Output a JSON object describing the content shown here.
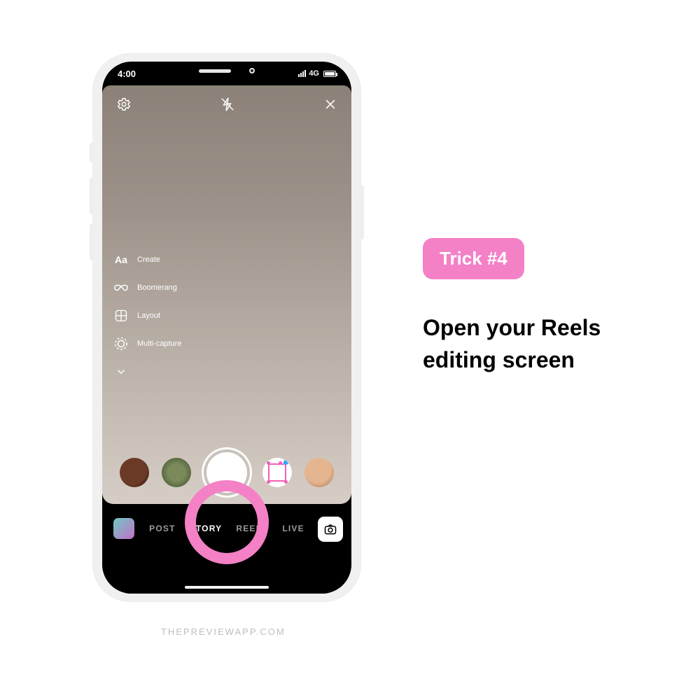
{
  "status": {
    "time": "4:00",
    "network": "4G"
  },
  "tools": {
    "create": "Create",
    "boomerang": "Boomerang",
    "layout": "Layout",
    "multicapture": "Multi-capture"
  },
  "modes": {
    "post": "POST",
    "story": "STORY",
    "reels": "REELS",
    "live": "LIVE"
  },
  "copy": {
    "badge": "Trick #4",
    "headline": "Open your Reels editing screen"
  },
  "watermark": "THEPREVIEWAPP.COM"
}
